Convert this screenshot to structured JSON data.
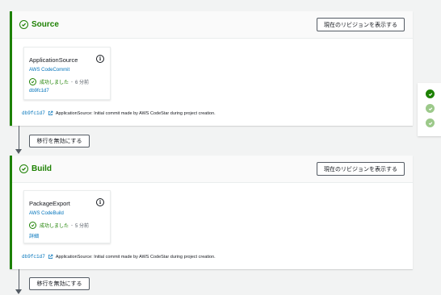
{
  "stages": [
    {
      "name": "Source",
      "rev_button": "現在のリビジョンを表示する",
      "action": {
        "name": "ApplicationSource",
        "provider": "AWS CodeCommit",
        "status": "成功しました",
        "time": "6 分前",
        "detail": "db9fc1d7"
      },
      "commit": {
        "id": "db9fc1d7",
        "message": "ApplicationSource: Initial commit made by AWS CodeStar during project creation."
      }
    },
    {
      "name": "Build",
      "rev_button": "現在のリビジョンを表示する",
      "action": {
        "name": "PackageExport",
        "provider": "AWS CodeBuild",
        "status": "成功しました",
        "time": "5 分前",
        "detail": "詳細"
      },
      "commit": {
        "id": "db9fc1d7",
        "message": "ApplicationSource: Initial commit made by AWS CodeStar during project creation."
      }
    }
  ],
  "transitions": [
    {
      "label": "移行を無効にする"
    },
    {
      "label": "移行を無効にする"
    }
  ],
  "status_separator": "-",
  "colors": {
    "success": "#1d8102",
    "link": "#0073bb",
    "page_bg": "#f2f3f3"
  },
  "icons": {
    "stage_status": "check-circle-icon",
    "info": "info-icon",
    "external": "external-link-icon",
    "side_nav": "check-circle-icon"
  }
}
